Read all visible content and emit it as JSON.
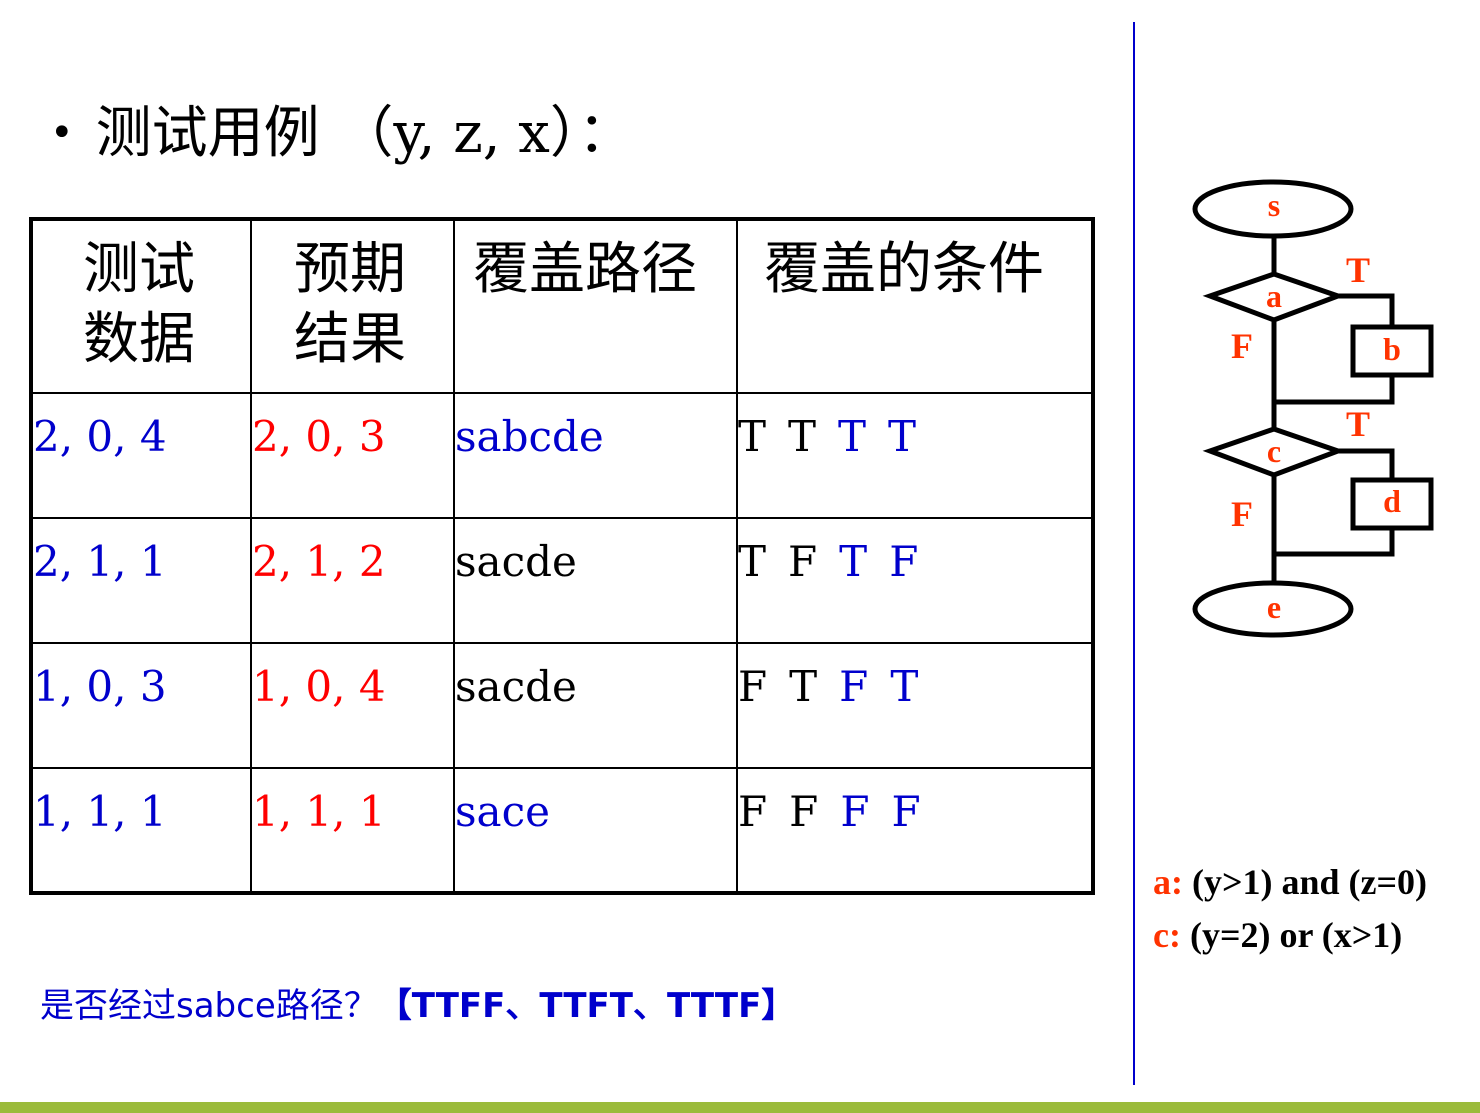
{
  "title": {
    "bullet": "•",
    "text": "测试用例 （y, z, x）："
  },
  "table": {
    "headers": [
      [
        "测试",
        "数据"
      ],
      [
        "预期",
        "结果"
      ],
      [
        "覆盖路径"
      ],
      [
        "覆盖的条件"
      ]
    ],
    "rows": [
      {
        "data": "2, 0, 4",
        "expected": "2, 0, 3",
        "path": "sabcde",
        "path_color": "#0000cc",
        "conds": [
          "T",
          "T",
          "T",
          "T"
        ]
      },
      {
        "data": "2, 1, 1",
        "expected": "2, 1, 2",
        "path": "sacde",
        "path_color": "#000000",
        "conds": [
          "T",
          "F",
          "T",
          "F"
        ]
      },
      {
        "data": "1, 0, 3",
        "expected": "1, 0, 4",
        "path": "sacde",
        "path_color": "#000000",
        "conds": [
          "F",
          "T",
          "F",
          "T"
        ]
      },
      {
        "data": "1, 1, 1",
        "expected": "1, 1, 1",
        "path": "sace",
        "path_color": "#0000cc",
        "conds": [
          "F",
          "F",
          "F",
          "F"
        ]
      }
    ]
  },
  "question": {
    "text": "是否经过sabce路径？",
    "answer": "【TTFF、TTFT、TTTF】"
  },
  "flowchart": {
    "nodes": {
      "s": "s",
      "a": "a",
      "b": "b",
      "c": "c",
      "d": "d",
      "e": "e"
    },
    "edge_labels": {
      "a_true": "T",
      "a_false": "F",
      "c_true": "T",
      "c_false": "F"
    }
  },
  "legend": [
    {
      "key": "a:",
      "expr": " (y>1) and (z=0)"
    },
    {
      "key": "c:",
      "expr": " (y=2) or (x>1)"
    }
  ],
  "colors": {
    "accent_blue": "#0000cc",
    "red": "#ff0000",
    "label_orange": "#ff3300",
    "bar_green": "#9bbb3b"
  }
}
